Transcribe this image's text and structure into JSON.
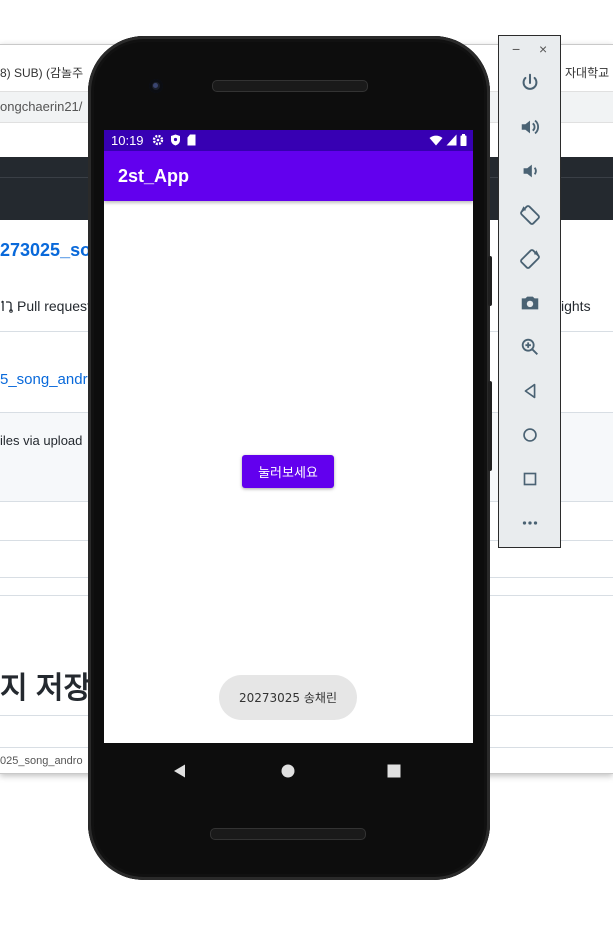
{
  "browser": {
    "tab_left_text": "8) SUB) (감놀주",
    "tab_right_text": "자대학교",
    "address_text": "ongchaerin21/",
    "repo_title": "273025_sor",
    "nav_pull_requests": "Pull request",
    "nav_insights": "ights",
    "branch_text": "5_song_andro",
    "commit_text": "iles via upload",
    "heading_text": "지 저장",
    "status_text": "025_song_andro"
  },
  "emulator_toolbar": {
    "minimize_label": "−",
    "close_label": "×",
    "buttons": [
      {
        "name": "power-icon"
      },
      {
        "name": "volume-up-icon"
      },
      {
        "name": "volume-down-icon"
      },
      {
        "name": "rotate-left-icon"
      },
      {
        "name": "rotate-right-icon"
      },
      {
        "name": "camera-icon"
      },
      {
        "name": "zoom-icon"
      },
      {
        "name": "back-icon"
      },
      {
        "name": "home-icon"
      },
      {
        "name": "overview-icon"
      },
      {
        "name": "more-icon"
      }
    ]
  },
  "phone": {
    "status_bar": {
      "time": "10:19",
      "left_icons": [
        "settings-icon",
        "shield-icon",
        "sd-card-icon"
      ],
      "right_icons": [
        "wifi-icon",
        "signal-icon",
        "battery-icon"
      ]
    },
    "app_bar": {
      "title": "2st_App"
    },
    "main_button_label": "눌러보세요",
    "toast_text": "20273025 송채린",
    "nav_buttons": [
      "back-icon",
      "home-icon",
      "recents-icon"
    ]
  },
  "colors": {
    "status_bar": "#3700b3",
    "app_bar": "#6200ee",
    "button": "#6200ee",
    "toast_bg": "#e6e6e6"
  }
}
